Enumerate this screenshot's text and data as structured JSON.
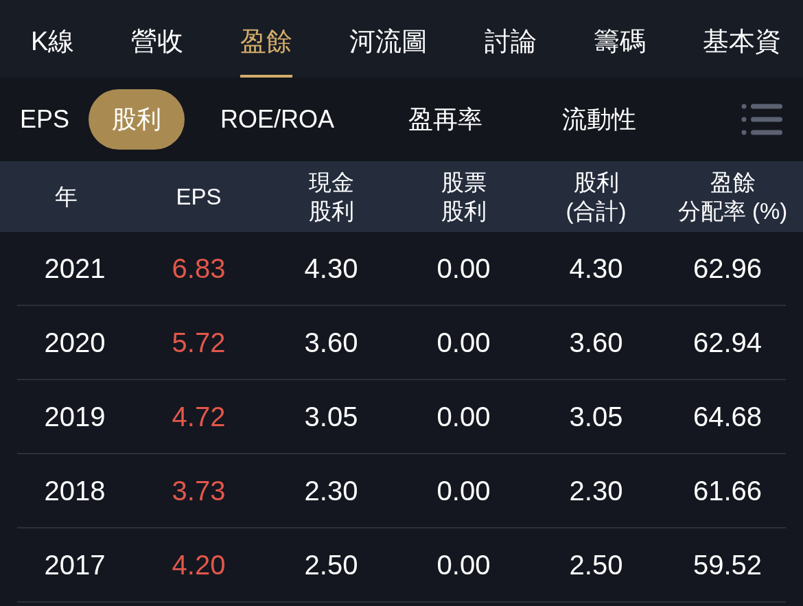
{
  "tabs": [
    {
      "label": "K線",
      "selected": false
    },
    {
      "label": "營收",
      "selected": false
    },
    {
      "label": "盈餘",
      "selected": true
    },
    {
      "label": "河流圖",
      "selected": false
    },
    {
      "label": "討論",
      "selected": false
    },
    {
      "label": "籌碼",
      "selected": false
    },
    {
      "label": "基本資",
      "selected": false
    }
  ],
  "subtabs": [
    {
      "label": "EPS",
      "selected": false
    },
    {
      "label": "股利",
      "selected": true
    },
    {
      "label": "ROE/ROA",
      "selected": false
    },
    {
      "label": "盈再率",
      "selected": false
    },
    {
      "label": "流動性",
      "selected": false
    }
  ],
  "table": {
    "columns": [
      {
        "lines": [
          "年"
        ]
      },
      {
        "lines": [
          "EPS"
        ]
      },
      {
        "lines": [
          "現金",
          "股利"
        ]
      },
      {
        "lines": [
          "股票",
          "股利"
        ]
      },
      {
        "lines": [
          "股利",
          "(合計)"
        ]
      },
      {
        "lines": [
          "盈餘",
          "分配率 (%)"
        ]
      }
    ],
    "rows": [
      [
        "2021",
        "6.83",
        "4.30",
        "0.00",
        "4.30",
        "62.96"
      ],
      [
        "2020",
        "5.72",
        "3.60",
        "0.00",
        "3.60",
        "62.94"
      ],
      [
        "2019",
        "4.72",
        "3.05",
        "0.00",
        "3.05",
        "64.68"
      ],
      [
        "2018",
        "3.73",
        "2.30",
        "0.00",
        "2.30",
        "61.66"
      ],
      [
        "2017",
        "4.20",
        "2.50",
        "0.00",
        "2.50",
        "59.52"
      ]
    ]
  }
}
